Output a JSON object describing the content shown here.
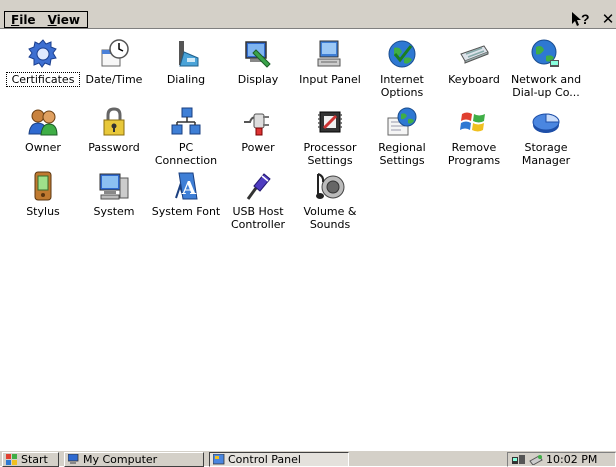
{
  "menubar": {
    "file": {
      "first": "F",
      "rest": "ile"
    },
    "view": {
      "first": "V",
      "rest": "iew"
    },
    "help_icon": "help-question-arrow-icon",
    "close_label": "✕"
  },
  "items": [
    {
      "label": "Certificates",
      "icon": "certificates-icon",
      "selected": true
    },
    {
      "label": "Date/Time",
      "icon": "clock-icon"
    },
    {
      "label": "Dialing",
      "icon": "phone-icon"
    },
    {
      "label": "Display",
      "icon": "display-icon"
    },
    {
      "label": "Input Panel",
      "icon": "input-panel-icon"
    },
    {
      "label": "Internet Options",
      "icon": "globe-check-icon"
    },
    {
      "label": "Keyboard",
      "icon": "keyboard-icon"
    },
    {
      "label": "Network and Dial-up Co...",
      "icon": "network-globe-icon"
    },
    {
      "label": "Owner",
      "icon": "users-icon"
    },
    {
      "label": "Password",
      "icon": "padlock-icon"
    },
    {
      "label": "PC Connection",
      "icon": "pc-connection-icon"
    },
    {
      "label": "Power",
      "icon": "power-plug-icon"
    },
    {
      "label": "Processor Settings",
      "icon": "processor-icon"
    },
    {
      "label": "Regional Settings",
      "icon": "regional-globe-icon"
    },
    {
      "label": "Remove Programs",
      "icon": "windows-flag-icon"
    },
    {
      "label": "Storage Manager",
      "icon": "storage-pie-icon"
    },
    {
      "label": "Stylus",
      "icon": "stylus-device-icon"
    },
    {
      "label": "System",
      "icon": "computer-icon"
    },
    {
      "label": "System Font",
      "icon": "font-icon"
    },
    {
      "label": "USB Host Controller",
      "icon": "usb-icon"
    },
    {
      "label": "Volume & Sounds",
      "icon": "speaker-icon"
    }
  ],
  "taskbar": {
    "start_label": "Start",
    "my_computer_label": "My Computer",
    "control_panel_label": "Control Panel",
    "clock": "10:02 PM"
  }
}
